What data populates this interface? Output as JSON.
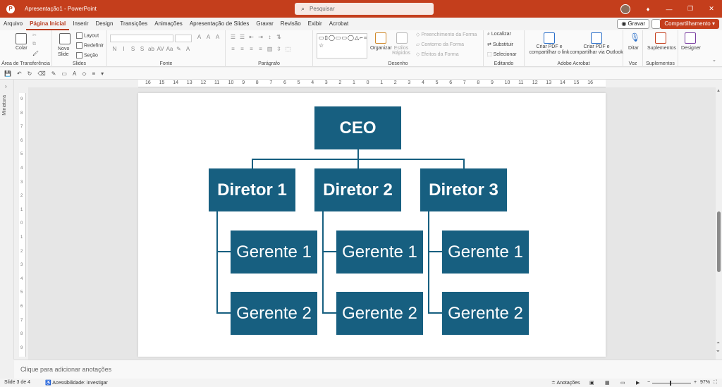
{
  "window": {
    "doc_title": "Apresentação1  -  PowerPoint",
    "search_placeholder": "Pesquisar"
  },
  "menu": {
    "tabs": [
      "Arquivo",
      "Página Inicial",
      "Inserir",
      "Design",
      "Transições",
      "Animações",
      "Apresentação de Slides",
      "Gravar",
      "Revisão",
      "Exibir",
      "Acrobat"
    ],
    "active_tab": "Página Inicial",
    "record_label": "Gravar",
    "share_label": "Compartilhamento"
  },
  "ribbon": {
    "clipboard": {
      "paste": "Colar",
      "label": "Área de Transferência"
    },
    "slides": {
      "new_slide": "Novo Slide",
      "layout": "Layout",
      "reset": "Redefinir",
      "section": "Seção",
      "label": "Slides"
    },
    "font": {
      "label": "Fonte"
    },
    "paragraph": {
      "label": "Parágrafo"
    },
    "drawing": {
      "arrange": "Organizar",
      "quick_styles": "Estilos Rápidos",
      "shape_fill": "Preenchimento da Forma",
      "shape_outline": "Contorno da Forma",
      "shape_effects": "Efeitos da Forma",
      "label": "Desenho"
    },
    "editing": {
      "find": "Localizar",
      "replace": "Substituir",
      "select": "Selecionar",
      "label": "Editando"
    },
    "acrobat": {
      "create_pdf_link": "Criar PDF e compartilhar o link",
      "create_pdf_outlook": "Criar PDF e compartilhar via Outlook",
      "label": "Adobe Acrobat"
    },
    "voice": {
      "dictate": "Ditar",
      "label": "Voz"
    },
    "addins": {
      "addins": "Suplementos",
      "label": "Suplementos"
    },
    "designer": {
      "designer": "Designer"
    }
  },
  "panes": {
    "thumbnails_label": "Miniatura",
    "notes_placeholder": "Clique para adicionar anotações"
  },
  "ruler": {
    "h_ticks": [
      "16",
      "15",
      "14",
      "13",
      "12",
      "11",
      "10",
      "9",
      "8",
      "7",
      "6",
      "5",
      "4",
      "3",
      "2",
      "1",
      "0",
      "1",
      "2",
      "3",
      "4",
      "5",
      "6",
      "7",
      "8",
      "9",
      "10",
      "11",
      "12",
      "13",
      "14",
      "15",
      "16"
    ],
    "v_ticks": [
      "9",
      "8",
      "7",
      "6",
      "5",
      "4",
      "3",
      "2",
      "1",
      "0",
      "1",
      "2",
      "3",
      "4",
      "5",
      "6",
      "7",
      "8",
      "9"
    ]
  },
  "org_chart": {
    "ceo": "CEO",
    "directors": [
      "Diretor 1",
      "Diretor 2",
      "Diretor 3"
    ],
    "managers": [
      [
        "Gerente 1",
        "Gerente 2"
      ],
      [
        "Gerente 1",
        "Gerente 2"
      ],
      [
        "Gerente 1",
        "Gerente 2"
      ]
    ],
    "box_color": "#175f80",
    "text_color": "#ffffff"
  },
  "status": {
    "slide_info": "Slide 3 de 4",
    "accessibility": "Acessibilidade: investigar",
    "notes": "Anotações",
    "zoom": "97%"
  },
  "colors": {
    "accent": "#c43e1c",
    "slide_box": "#175f80"
  }
}
